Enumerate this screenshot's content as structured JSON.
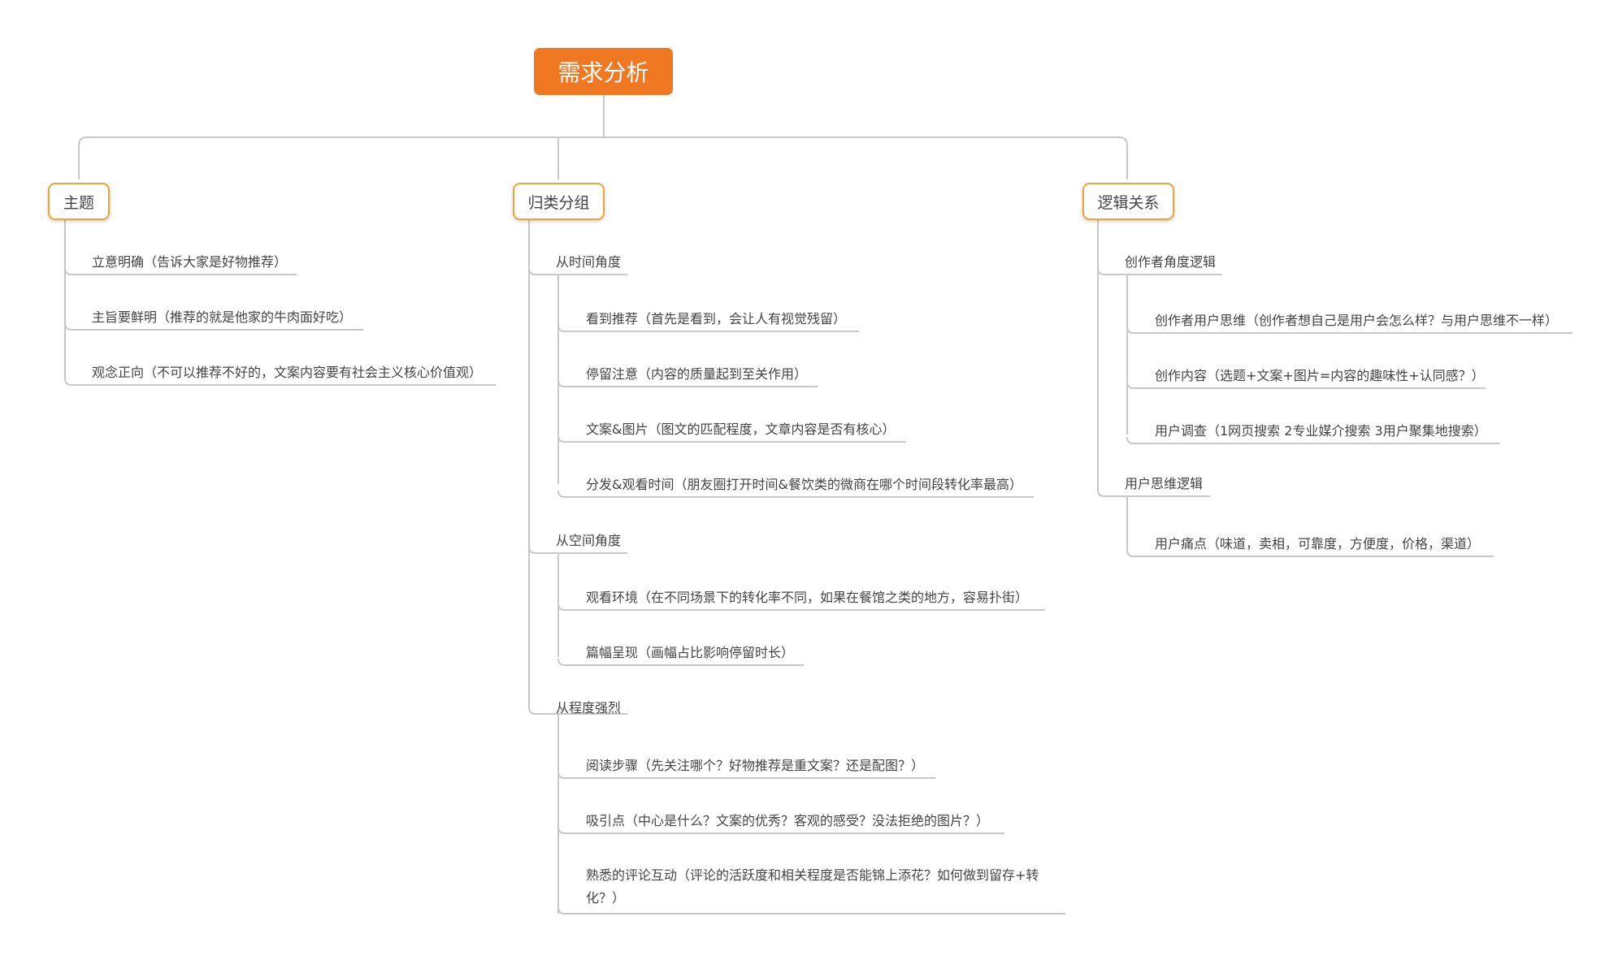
{
  "root": {
    "label": "需求分析",
    "color": "#f07822"
  },
  "branches": [
    {
      "label": "主题",
      "items": [
        {
          "label": "立意明确（告诉大家是好物推荐）"
        },
        {
          "label": "主旨要鲜明（推荐的就是他家的牛肉面好吃）"
        },
        {
          "label": "观念正向（不可以推荐不好的，文案内容要有社会主义核心价值观）"
        }
      ]
    },
    {
      "label": "归类分组",
      "groups": [
        {
          "label": "从时间角度",
          "items": [
            {
              "label": "看到推荐（首先是看到，会让人有视觉残留）"
            },
            {
              "label": "停留注意（内容的质量起到至关作用）"
            },
            {
              "label": "文案&图片（图文的匹配程度，文章内容是否有核心）"
            },
            {
              "label": "分发&观看时间（朋友圈打开时间&餐饮类的微商在哪个时间段转化率最高）"
            }
          ]
        },
        {
          "label": "从空间角度",
          "items": [
            {
              "label": "观看环境（在不同场景下的转化率不同，如果在餐馆之类的地方，容易扑街）"
            },
            {
              "label": "篇幅呈现（画幅占比影响停留时长）"
            }
          ]
        },
        {
          "label": "从程度强烈",
          "items": [
            {
              "label": "阅读步骤（先关注哪个？好物推荐是重文案？还是配图？）"
            },
            {
              "label": "吸引点（中心是什么？文案的优秀？客观的感受？没法拒绝的图片？）"
            },
            {
              "label": "熟悉的评论互动（评论的活跃度和相关程度是否能锦上添花？如何做到留存+转化？）"
            }
          ]
        }
      ]
    },
    {
      "label": "逻辑关系",
      "groups": [
        {
          "label": "创作者角度逻辑",
          "items": [
            {
              "label": "创作者用户思维（创作者想自己是用户会怎么样？与用户思维不一样）"
            },
            {
              "label": "创作内容（选题+文案+图片=内容的趣味性+认同感？）"
            },
            {
              "label": "用户调查（1网页搜索  2专业媒介搜索 3用户聚集地搜索）"
            }
          ]
        },
        {
          "label": "用户思维逻辑",
          "items": [
            {
              "label": "用户痛点（味道，卖相，可靠度，方便度，价格，渠道）"
            }
          ]
        }
      ]
    }
  ],
  "colors": {
    "branch_border": "#f5a136",
    "line": "#c8c8c8",
    "text": "#444444"
  }
}
